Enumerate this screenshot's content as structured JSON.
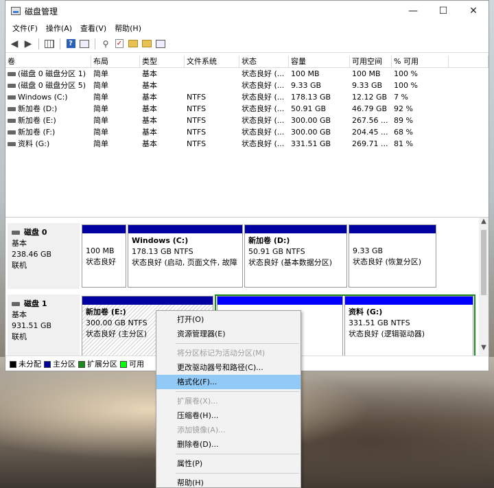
{
  "window": {
    "title": "磁盘管理",
    "controls": [
      "—",
      "☐",
      "✕"
    ]
  },
  "menu": [
    "文件(F)",
    "操作(A)",
    "查看(V)",
    "帮助(H)"
  ],
  "table": {
    "headers": [
      "卷",
      "布局",
      "类型",
      "文件系统",
      "状态",
      "容量",
      "可用空间",
      "% 可用",
      ""
    ],
    "rows": [
      [
        "(磁盘 0 磁盘分区 1)",
        "简单",
        "基本",
        "",
        "状态良好 (...",
        "100 MB",
        "100 MB",
        "100 %"
      ],
      [
        "(磁盘 0 磁盘分区 5)",
        "简单",
        "基本",
        "",
        "状态良好 (...",
        "9.33 GB",
        "9.33 GB",
        "100 %"
      ],
      [
        "Windows (C:)",
        "简单",
        "基本",
        "NTFS",
        "状态良好 (...",
        "178.13 GB",
        "12.12 GB",
        "7 %"
      ],
      [
        "新加卷 (D:)",
        "简单",
        "基本",
        "NTFS",
        "状态良好 (...",
        "50.91 GB",
        "46.79 GB",
        "92 %"
      ],
      [
        "新加卷 (E:)",
        "简单",
        "基本",
        "NTFS",
        "状态良好 (...",
        "300.00 GB",
        "267.56 ...",
        "89 %"
      ],
      [
        "新加卷 (F:)",
        "简单",
        "基本",
        "NTFS",
        "状态良好 (...",
        "300.00 GB",
        "204.45 ...",
        "68 %"
      ],
      [
        "资料 (G:)",
        "简单",
        "基本",
        "NTFS",
        "状态良好 (...",
        "331.51 GB",
        "269.71 ...",
        "81 %"
      ]
    ]
  },
  "disks": [
    {
      "name": "磁盘 0",
      "type": "基本",
      "size": "238.46 GB",
      "status": "联机",
      "partitions": [
        {
          "name": "",
          "size": "100 MB",
          "status": "状态良好"
        },
        {
          "name": "Windows  (C:)",
          "size": "178.13 GB NTFS",
          "status": "状态良好 (启动, 页面文件, 故障"
        },
        {
          "name": "新加卷  (D:)",
          "size": "50.91 GB NTFS",
          "status": "状态良好 (基本数据分区)"
        },
        {
          "name": "",
          "size": "9.33 GB",
          "status": "状态良好 (恢复分区)"
        }
      ]
    },
    {
      "name": "磁盘 1",
      "type": "基本",
      "size": "931.51 GB",
      "status": "联机",
      "partitions": [
        {
          "name": "新加卷  (E:)",
          "size": "300.00 GB NTFS",
          "status": "状态良好 (主分区)"
        },
        {
          "name": "",
          "size": "",
          "status": ""
        },
        {
          "name": "资料  (G:)",
          "size": "331.51 GB NTFS",
          "status": "状态良好 (逻辑驱动器)"
        }
      ]
    }
  ],
  "legend": [
    {
      "label": "未分配",
      "color": "#000000"
    },
    {
      "label": "主分区",
      "color": "#0000a0"
    },
    {
      "label": "扩展分区",
      "color": "#1a8a1a"
    },
    {
      "label": "可用",
      "color": "#00ff00"
    }
  ],
  "context_menu": {
    "items": [
      {
        "label": "打开(O)",
        "disabled": false
      },
      {
        "label": "资源管理器(E)",
        "disabled": false
      },
      {
        "sep": true
      },
      {
        "label": "将分区标记为活动分区(M)",
        "disabled": true
      },
      {
        "label": "更改驱动器号和路径(C)...",
        "disabled": false
      },
      {
        "label": "格式化(F)...",
        "disabled": false,
        "hover": true
      },
      {
        "sep": true
      },
      {
        "label": "扩展卷(X)...",
        "disabled": true
      },
      {
        "label": "压缩卷(H)...",
        "disabled": false
      },
      {
        "label": "添加镜像(A)...",
        "disabled": true
      },
      {
        "label": "删除卷(D)...",
        "disabled": false
      },
      {
        "sep": true
      },
      {
        "label": "属性(P)",
        "disabled": false
      },
      {
        "sep": true
      },
      {
        "label": "帮助(H)",
        "disabled": false
      }
    ]
  }
}
